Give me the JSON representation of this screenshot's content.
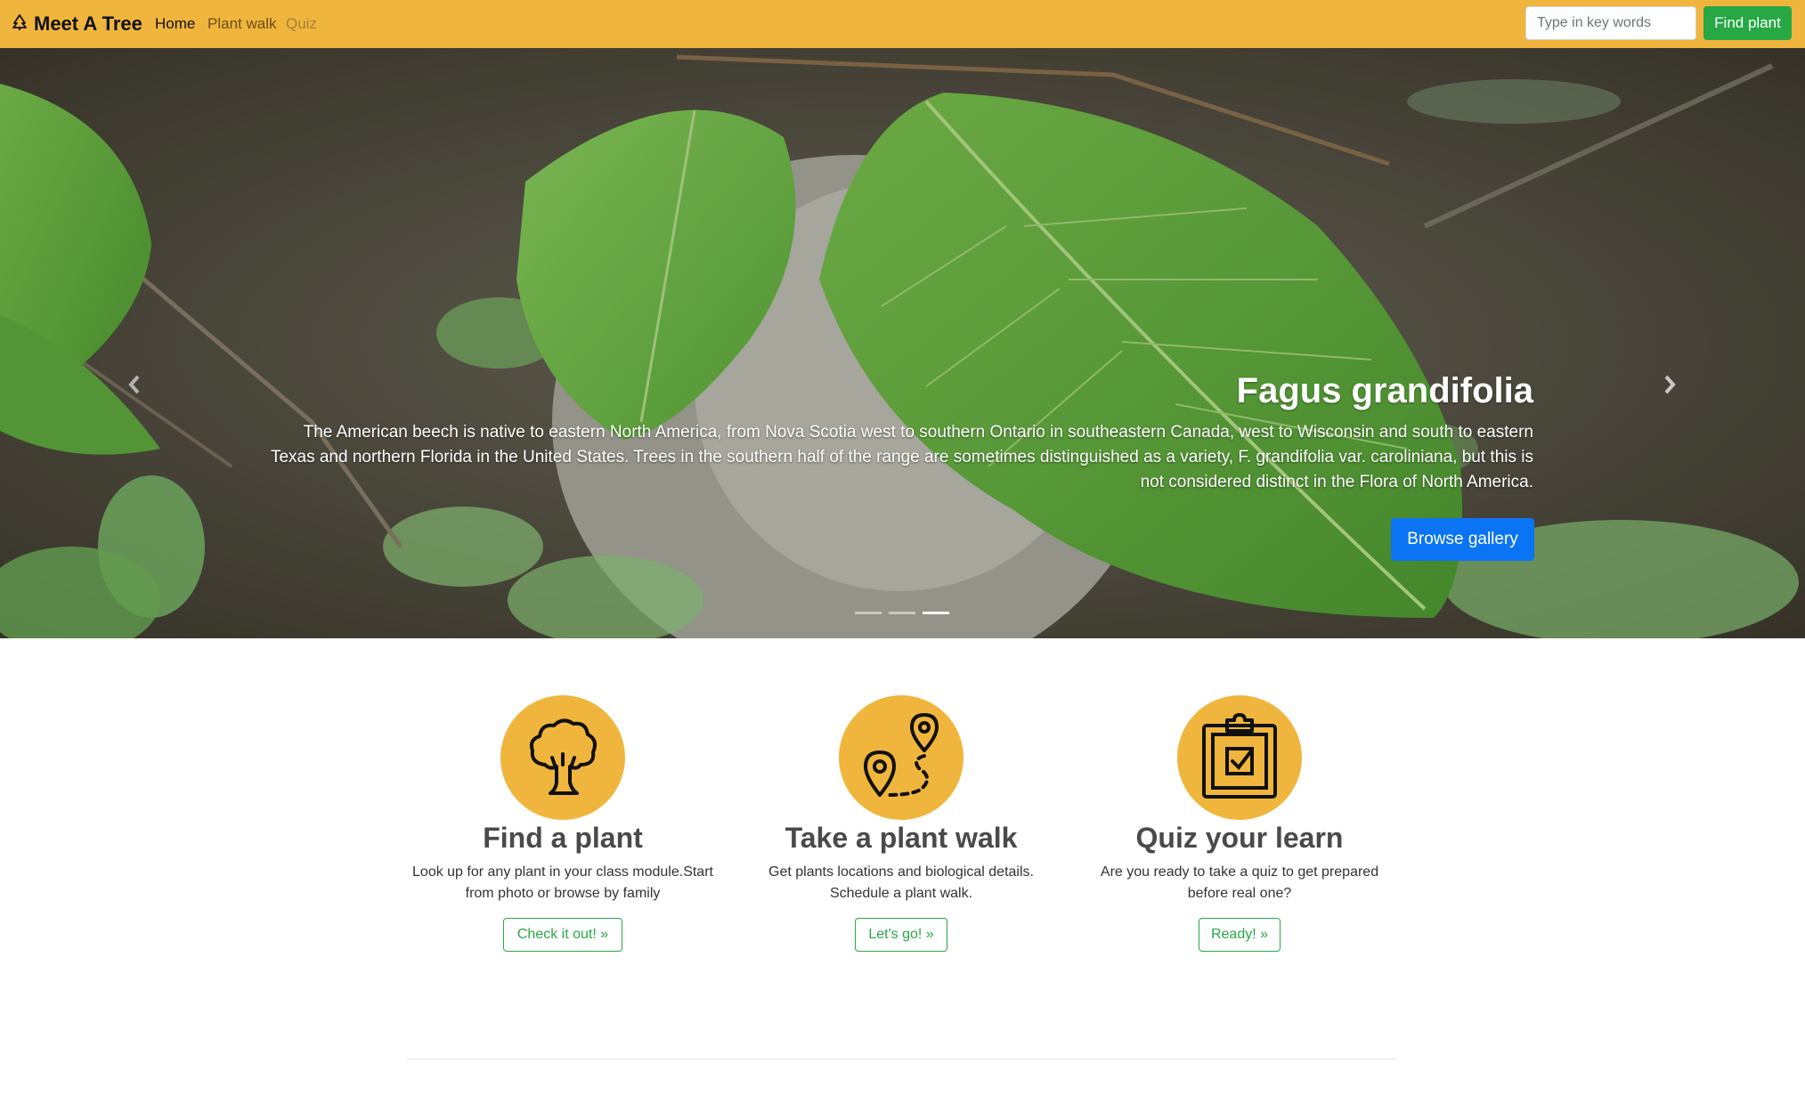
{
  "nav": {
    "brand": "Meet A Tree",
    "links": [
      {
        "label": "Home"
      },
      {
        "label": "Plant walk"
      },
      {
        "label": "Quiz"
      }
    ],
    "search_placeholder": "Type in key words",
    "search_button": "Find plant",
    "brand_icon": "tree-icon",
    "bar_color": "#f0b53c"
  },
  "hero": {
    "title": "Fagus grandifolia",
    "description": "The American beech is native to eastern North America, from Nova Scotia west to southern Ontario in southeastern Canada, west to Wisconsin and south to eastern Texas and northern Florida in the United States. Trees in the southern half of the range are sometimes distinguished as a variety, F. grandifolia var. caroliniana, but this is not considered distinct in the Flora of North America.",
    "button": "Browse gallery",
    "slides_total": 3,
    "active_slide": 3,
    "prev_icon": "chevron-left-icon",
    "next_icon": "chevron-right-icon",
    "button_color": "#0b74f5"
  },
  "features": [
    {
      "title": "Find a plant",
      "description": "Look up for any plant in your class module.Start from photo or browse by family",
      "button": "Check it out! »",
      "icon": "tree-icon"
    },
    {
      "title": "Take a plant walk",
      "description": "Get plants locations and biological details. Schedule a plant walk.",
      "button": "Let's go! »",
      "icon": "map-route-icon"
    },
    {
      "title": "Quiz your learn",
      "description": "Are you ready to take a quiz to get prepared before real one?",
      "button": "Ready! »",
      "icon": "clipboard-check-icon"
    }
  ],
  "colors": {
    "accent": "#f0b53c",
    "success": "#28a745"
  }
}
